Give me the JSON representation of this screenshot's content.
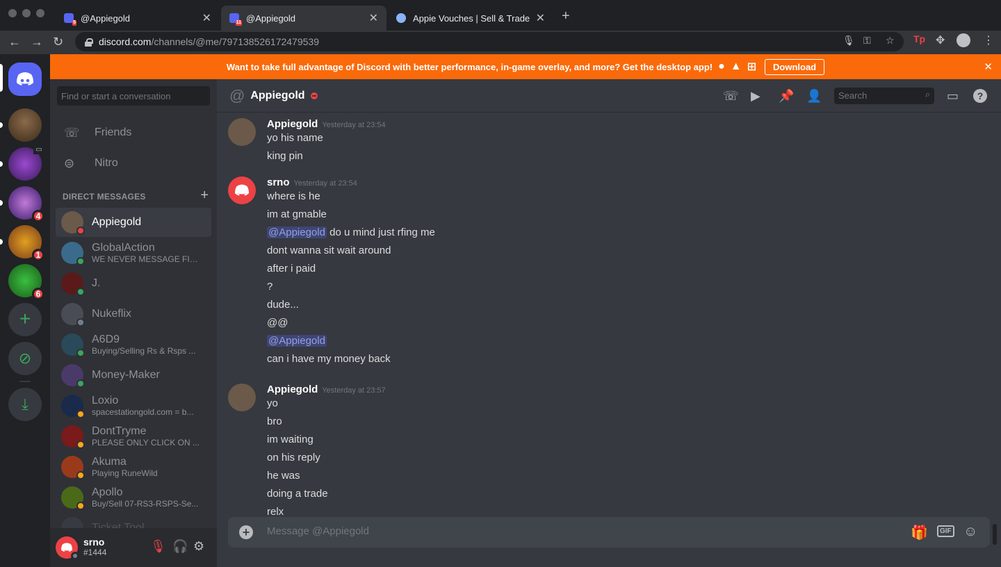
{
  "browser": {
    "tabs": [
      {
        "title": "@Appiegold",
        "badge": "5"
      },
      {
        "title": "@Appiegold",
        "badge": "11"
      },
      {
        "title": "Appie Vouches | Sell & Trade G"
      }
    ],
    "url_host": "discord.com",
    "url_path": "/channels/@me/797138526172479539"
  },
  "banner": {
    "text": "Want to take full advantage of Discord with better performance, in-game overlay, and more? Get the desktop app!",
    "download_label": "Download"
  },
  "guilds": [
    {
      "badge": ""
    },
    {
      "badge": ""
    },
    {
      "badge": "4"
    },
    {
      "badge": "1"
    },
    {
      "badge": "6"
    }
  ],
  "sidebar": {
    "search_placeholder": "Find or start a conversation",
    "friends_label": "Friends",
    "nitro_label": "Nitro",
    "dm_header": "DIRECT MESSAGES",
    "dms": [
      {
        "name": "Appiegold",
        "sub": "",
        "status": "dnd",
        "color": "#6b5a4a"
      },
      {
        "name": "GlobalAction",
        "sub": "WE NEVER MESSAGE FIRST",
        "status": "online",
        "color": "#3a6b8c"
      },
      {
        "name": "J.",
        "sub": "",
        "status": "online",
        "color": "#5a1a1a"
      },
      {
        "name": "Nukeflix",
        "sub": "",
        "status": "offline",
        "color": "#4a4c55"
      },
      {
        "name": "A6D9",
        "sub": "Buying/Selling Rs & Rsps ...",
        "status": "online",
        "color": "#2a4a5a"
      },
      {
        "name": "Money-Maker",
        "sub": "",
        "status": "online",
        "color": "#4a3a6a"
      },
      {
        "name": "Loxio",
        "sub": "spacestationgold.com = b...",
        "status": "idle",
        "color": "#1a2a4a"
      },
      {
        "name": "DontTryme",
        "sub": "PLEASE ONLY CLICK ON ...",
        "status": "idle",
        "color": "#7a1a1a"
      },
      {
        "name": "Akuma",
        "sub": "Playing RuneWild",
        "status": "idle",
        "color": "#9a3a1a"
      },
      {
        "name": "Apollo",
        "sub": "Buy/Sell 07-RS3-RSPS-Se...",
        "status": "idle",
        "color": "#4a6a1a"
      },
      {
        "name": "Ticket Tool",
        "sub": "",
        "status": "",
        "color": "#4a4c55"
      }
    ]
  },
  "user": {
    "name": "srno",
    "tag": "#1444"
  },
  "chat": {
    "title": "Appiegold",
    "search_placeholder": "Search",
    "composer_placeholder": "Message @Appiegold",
    "groups": [
      {
        "author": "Appiegold",
        "time": "Yesterday at 23:54",
        "avatar_color": "#6b5a4a",
        "lines": [
          {
            "text": "yo his name"
          },
          {
            "text": "king pin"
          }
        ]
      },
      {
        "author": "srno",
        "time": "Yesterday at 23:54",
        "avatar_color": "#ed4245",
        "lines": [
          {
            "text": "where is he"
          },
          {
            "text": "im at gmable"
          },
          {
            "mention": "@Appiegold",
            "text": " do u mind just rfing me"
          },
          {
            "text": "dont wanna sit wait around"
          },
          {
            "text": "after i paid"
          },
          {
            "text": "?"
          },
          {
            "text": "dude..."
          },
          {
            "text": "@@"
          },
          {
            "mention": "@Appiegold",
            "text": ""
          },
          {
            "text": "can i have my money back"
          }
        ]
      },
      {
        "author": "Appiegold",
        "time": "Yesterday at 23:57",
        "avatar_color": "#6b5a4a",
        "lines": [
          {
            "text": "yo"
          },
          {
            "text": "bro"
          },
          {
            "text": "im waiting"
          },
          {
            "text": "on his reply"
          },
          {
            "text": "he was"
          },
          {
            "text": "doing a trade"
          },
          {
            "text": "relx"
          }
        ]
      }
    ]
  },
  "colors": {
    "accent": "#5865f2",
    "banner": "#fa6a0a",
    "online": "#3ba55d",
    "idle": "#faa81a",
    "dnd": "#ed4245"
  }
}
